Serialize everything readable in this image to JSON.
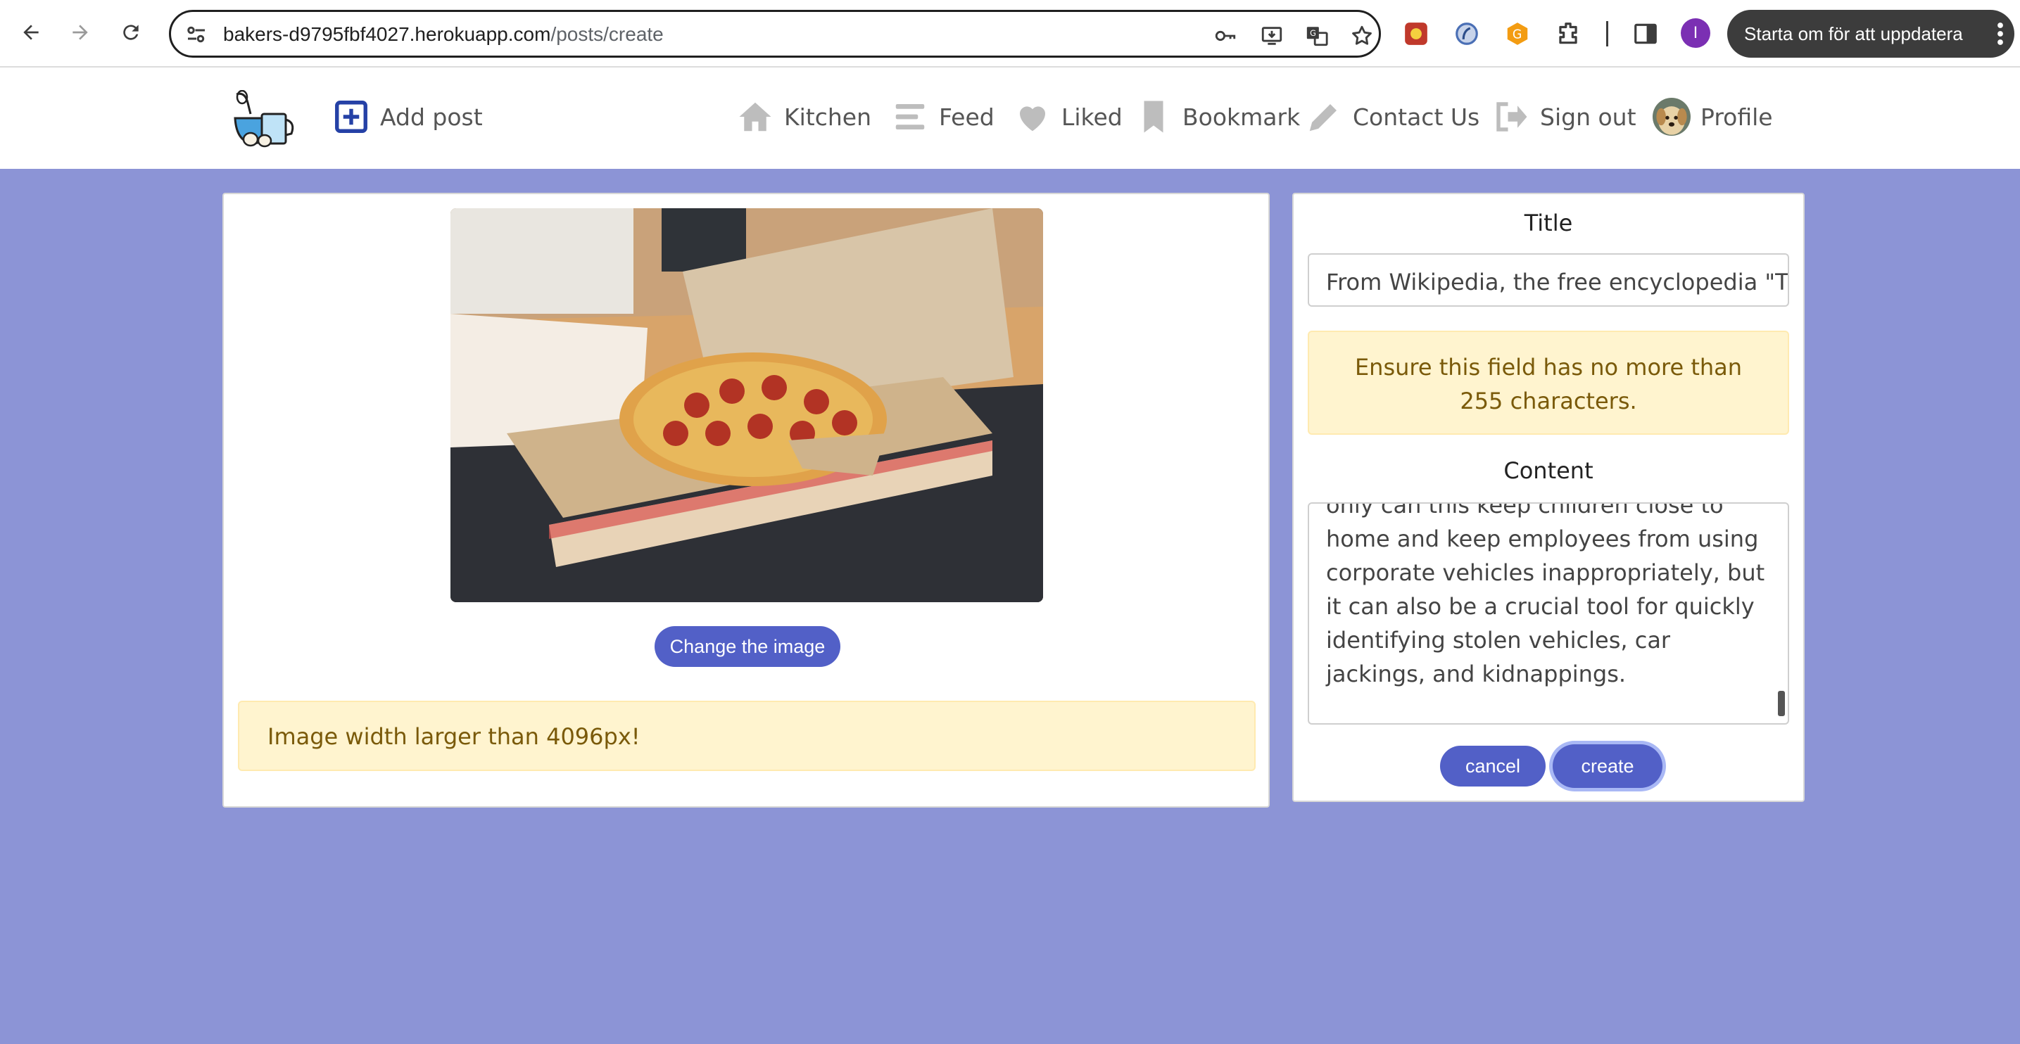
{
  "browser": {
    "url_host": "bakers-d9795fbf4027.herokuapp.com",
    "url_path": "/posts/create",
    "profile_initial": "I",
    "update_label": "Starta om för att uppdatera"
  },
  "navbar": {
    "add_post": "Add post",
    "links": {
      "kitchen": "Kitchen",
      "feed": "Feed",
      "liked": "Liked",
      "bookmark": "Bookmark",
      "contact": "Contact Us",
      "signout": "Sign out",
      "profile": "Profile"
    }
  },
  "image_panel": {
    "change_button": "Change the image",
    "error": "Image width larger than 4096px!"
  },
  "form": {
    "title_label": "Title",
    "title_value": "From Wikipedia, the free encyclopedia \"Tx",
    "title_error": "Ensure this field has no more than 255 characters.",
    "content_label": "Content",
    "content_value": "only can this keep children close to home and keep employees from using corporate vehicles inappropriately, but it can also be a crucial tool for quickly identifying stolen vehicles, car jackings, and kidnappings.",
    "cancel_label": "cancel",
    "create_label": "create"
  },
  "colors": {
    "page_background": "#8c94d6",
    "button": "#5260c7",
    "alert_background": "#fff4cf",
    "alert_text": "#7a5a0a"
  },
  "icons": [
    "back-icon",
    "forward-icon",
    "reload-icon",
    "site-settings-icon",
    "password-key-icon",
    "install-app-icon",
    "translate-icon",
    "bookmark-star-icon",
    "extensions-icon",
    "side-panel-icon",
    "kebab-menu-icon",
    "add-square-icon",
    "home-icon",
    "feed-lines-icon",
    "heart-icon",
    "bookmark-icon",
    "pencil-icon",
    "sign-out-icon"
  ]
}
